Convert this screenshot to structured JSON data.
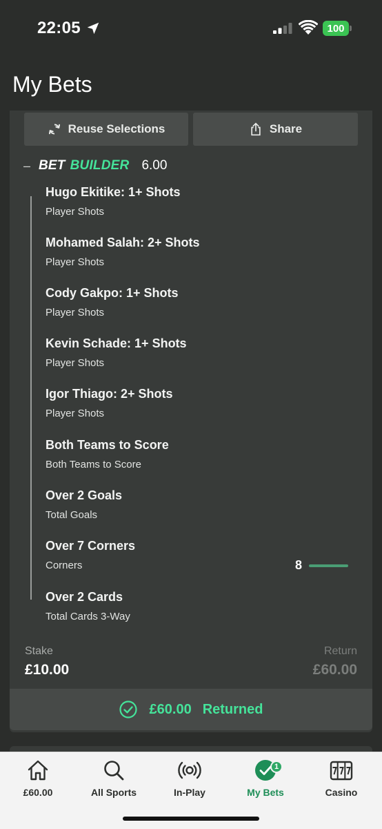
{
  "status_bar": {
    "time": "22:05",
    "battery": "100",
    "icons": [
      "location-arrow-icon",
      "signal-icon",
      "wifi-icon",
      "battery-icon"
    ]
  },
  "header": {
    "title": "My Bets"
  },
  "bet": {
    "reuse_label": "Reuse Selections",
    "share_label": "Share",
    "builder_prefix": "BET",
    "builder_suffix": "BUILDER",
    "odds": "6.00",
    "legs": [
      {
        "title": "Hugo Ekitike: 1+ Shots",
        "market": "Player Shots"
      },
      {
        "title": "Mohamed Salah: 2+ Shots",
        "market": "Player Shots"
      },
      {
        "title": "Cody Gakpo: 1+ Shots",
        "market": "Player Shots"
      },
      {
        "title": "Kevin Schade: 1+ Shots",
        "market": "Player Shots"
      },
      {
        "title": "Igor Thiago: 2+ Shots",
        "market": "Player Shots"
      },
      {
        "title": "Both Teams to Score",
        "market": "Both Teams to Score"
      },
      {
        "title": "Over 2 Goals",
        "market": "Total Goals"
      },
      {
        "title": "Over 7 Corners",
        "market": "Corners"
      },
      {
        "title": "Over 2 Cards",
        "market": "Total Cards 3-Way"
      }
    ],
    "corners_progress": {
      "count": "8",
      "fraction": 1.0
    },
    "stake_label": "Stake",
    "stake_value": "£10.00",
    "return_label": "Return",
    "return_value": "£60.00",
    "returned_amount": "£60.00",
    "returned_label": "Returned"
  },
  "tab_bar": {
    "tabs": [
      {
        "label": "£60.00",
        "icon": "home-icon",
        "active": false
      },
      {
        "label": "All Sports",
        "icon": "search-icon",
        "active": false
      },
      {
        "label": "In-Play",
        "icon": "live-broadcast-icon",
        "active": false
      },
      {
        "label": "My Bets",
        "icon": "check-circle-icon",
        "active": true,
        "badge": "1"
      },
      {
        "label": "Casino",
        "icon": "slot-machine-icon",
        "active": false
      }
    ]
  },
  "colors": {
    "accent_green": "#45e39a",
    "active_tab_green": "#1e8e57",
    "card_bg": "#383b39",
    "page_bg": "#2b2d2b"
  }
}
